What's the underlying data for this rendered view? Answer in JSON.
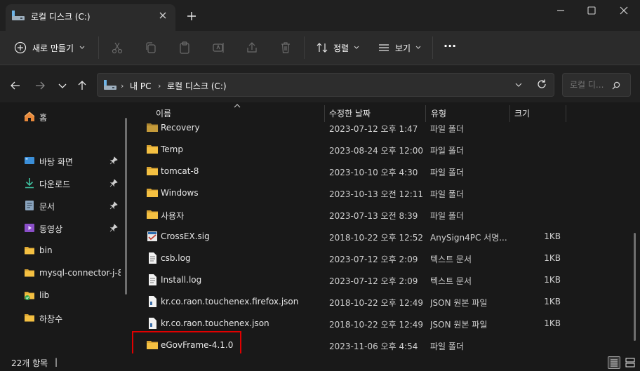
{
  "window": {
    "tab_title": "로컬 디스크 (C:)"
  },
  "toolbar": {
    "new_label": "새로 만들기",
    "sort_label": "정렬",
    "view_label": "보기",
    "more_label": "···"
  },
  "address": {
    "crumbs": [
      "내 PC",
      "로컬 디스크 (C:)"
    ]
  },
  "search": {
    "placeholder": "로컬 디..."
  },
  "sidebar": {
    "items": [
      {
        "label": "홈",
        "icon": "home-icon"
      },
      {
        "label": "바탕 화면",
        "icon": "desktop-icon",
        "pinned": true
      },
      {
        "label": "다운로드",
        "icon": "download-icon",
        "pinned": true
      },
      {
        "label": "문서",
        "icon": "document-icon",
        "pinned": true
      },
      {
        "label": "동영상",
        "icon": "video-icon",
        "pinned": true
      },
      {
        "label": "bin",
        "icon": "folder-icon"
      },
      {
        "label": "mysql-connector-j-8.",
        "icon": "folder-icon"
      },
      {
        "label": "lib",
        "icon": "folder-check-icon"
      },
      {
        "label": "하창수",
        "icon": "folder-icon"
      }
    ]
  },
  "columns": {
    "name": "이름",
    "date": "수정한 날짜",
    "type": "유형",
    "size": "크기"
  },
  "files": [
    {
      "name": "Recovery",
      "date": "2023-07-12 오후 1:47",
      "type": "파일 폴더",
      "size": "",
      "icon": "folder-icon"
    },
    {
      "name": "Temp",
      "date": "2023-08-24 오후 12:00",
      "type": "파일 폴더",
      "size": "",
      "icon": "folder-icon"
    },
    {
      "name": "tomcat-8",
      "date": "2023-10-10 오후 4:30",
      "type": "파일 폴더",
      "size": "",
      "icon": "folder-icon"
    },
    {
      "name": "Windows",
      "date": "2023-10-13 오전 12:11",
      "type": "파일 폴더",
      "size": "",
      "icon": "folder-icon"
    },
    {
      "name": "사용자",
      "date": "2023-07-13 오전 8:39",
      "type": "파일 폴더",
      "size": "",
      "icon": "folder-icon"
    },
    {
      "name": "CrossEX.sig",
      "date": "2018-10-22 오후 12:52",
      "type": "AnySign4PC 서명...",
      "size": "1KB",
      "icon": "signature-file-icon"
    },
    {
      "name": "csb.log",
      "date": "2023-07-12 오후 2:09",
      "type": "텍스트 문서",
      "size": "1KB",
      "icon": "text-file-icon"
    },
    {
      "name": "Install.log",
      "date": "2023-07-12 오후 2:09",
      "type": "텍스트 문서",
      "size": "1KB",
      "icon": "text-file-icon"
    },
    {
      "name": "kr.co.raon.touchenex.firefox.json",
      "date": "2018-10-22 오후 12:49",
      "type": "JSON 원본 파일",
      "size": "1KB",
      "icon": "json-file-icon"
    },
    {
      "name": "kr.co.raon.touchenex.json",
      "date": "2018-10-22 오후 12:49",
      "type": "JSON 원본 파일",
      "size": "1KB",
      "icon": "json-file-icon"
    },
    {
      "name": "eGovFrame-4.1.0",
      "date": "2023-11-06 오후 4:54",
      "type": "파일 폴더",
      "size": "",
      "icon": "folder-icon"
    }
  ],
  "status": {
    "count": "22개 항목",
    "separator": "|"
  },
  "colors": {
    "highlight": "#e00000",
    "folder": "#f4c042"
  }
}
